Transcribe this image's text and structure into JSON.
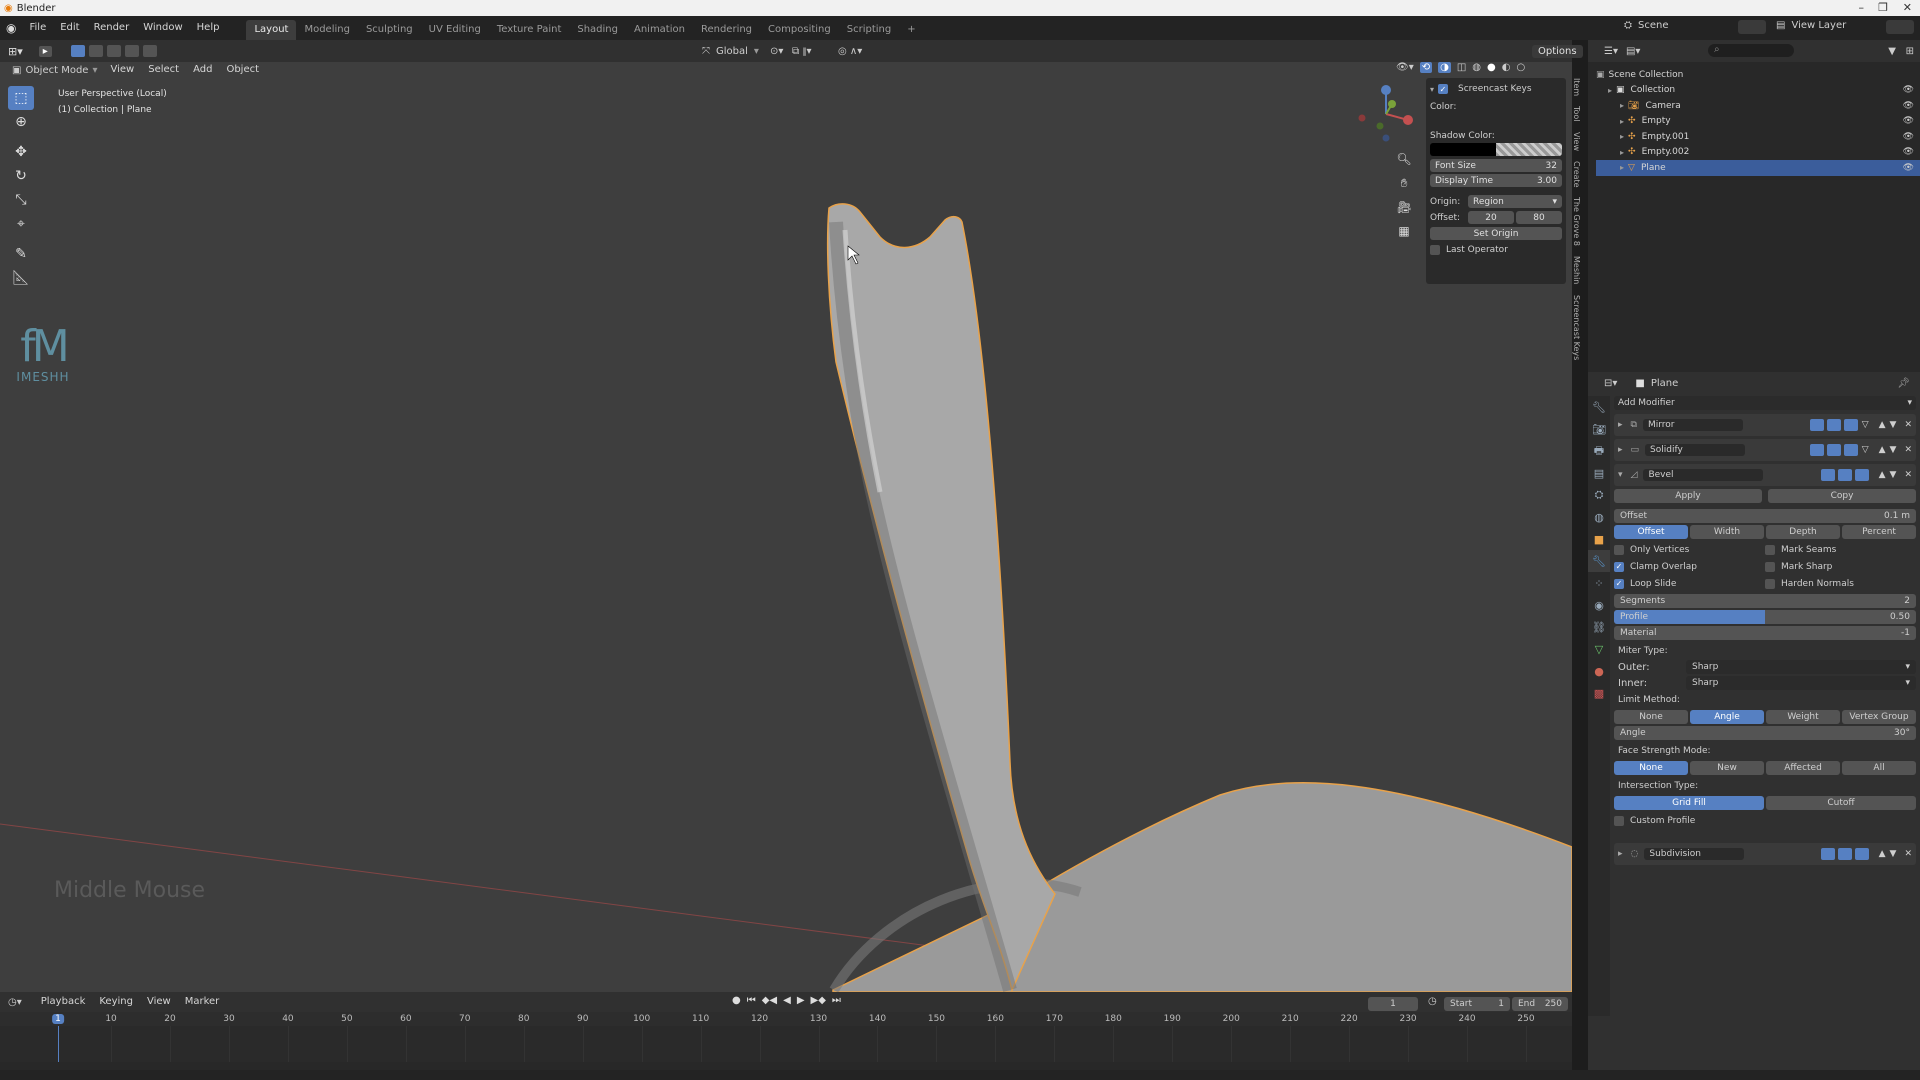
{
  "app": {
    "title": "Blender"
  },
  "menu": [
    "File",
    "Edit",
    "Render",
    "Window",
    "Help"
  ],
  "workspaces": [
    "Layout",
    "Modeling",
    "Sculpting",
    "UV Editing",
    "Texture Paint",
    "Shading",
    "Animation",
    "Rendering",
    "Compositing",
    "Scripting",
    "+"
  ],
  "top_right": {
    "scene": "Scene",
    "view_layer": "View Layer"
  },
  "viewport_header": {
    "mode": "Object Mode",
    "menus": [
      "View",
      "Select",
      "Add",
      "Object"
    ],
    "orientation": "Global",
    "options": "Options"
  },
  "viewport": {
    "perspective": "User Perspective (Local)",
    "collection": "(1) Collection | Plane",
    "overlay_text": "Middle Mouse",
    "logo_letters": "fM",
    "logo_text": "IMESHH"
  },
  "screencast": {
    "title": "Screencast Keys",
    "color_label": "Color:",
    "shadow_color_label": "Shadow Color:",
    "font_size_label": "Font Size",
    "font_size": "32",
    "display_time_label": "Display Time",
    "display_time": "3.00",
    "origin_label": "Origin:",
    "origin": "Region",
    "offset_label": "Offset:",
    "offset_x": "20",
    "offset_y": "80",
    "set_origin": "Set Origin",
    "last_operator": "Last Operator"
  },
  "side_tabs": [
    "Item",
    "Tool",
    "View",
    "Create",
    "The Grove 8",
    "Meshin",
    "Screencast Keys"
  ],
  "outliner": {
    "root": "Scene Collection",
    "items": [
      {
        "name": "Collection",
        "indent": 1
      },
      {
        "name": "Camera",
        "indent": 2
      },
      {
        "name": "Empty",
        "indent": 2
      },
      {
        "name": "Empty.001",
        "indent": 2
      },
      {
        "name": "Empty.002",
        "indent": 2
      },
      {
        "name": "Plane",
        "indent": 2,
        "selected": true
      }
    ]
  },
  "properties": {
    "object": "Plane",
    "add_modifier": "Add Modifier",
    "modifiers": [
      "Mirror",
      "Solidify",
      "Bevel",
      "Subdivision"
    ],
    "bevel": {
      "apply": "Apply",
      "copy": "Copy",
      "offset_label": "Offset",
      "offset_value": "0.1 m",
      "width_types": [
        "Offset",
        "Width",
        "Depth",
        "Percent"
      ],
      "only_vertices": "Only Vertices",
      "mark_seams": "Mark Seams",
      "clamp_overlap": "Clamp Overlap",
      "mark_sharp": "Mark Sharp",
      "loop_slide": "Loop Slide",
      "harden_normals": "Harden Normals",
      "segments_label": "Segments",
      "segments": "2",
      "profile_label": "Profile",
      "profile": "0.50",
      "profile_fraction": 0.5,
      "material_label": "Material",
      "material": "-1",
      "miter_type": "Miter Type:",
      "outer_label": "Outer:",
      "outer": "Sharp",
      "inner_label": "Inner:",
      "inner": "Sharp",
      "limit_method": "Limit Method:",
      "limit_options": [
        "None",
        "Angle",
        "Weight",
        "Vertex Group"
      ],
      "angle_label": "Angle",
      "angle": "30°",
      "face_strength": "Face Strength Mode:",
      "face_options": [
        "None",
        "New",
        "Affected",
        "All"
      ],
      "intersection": "Intersection Type:",
      "intersection_options": [
        "Grid Fill",
        "Cutoff"
      ],
      "custom_profile": "Custom Profile"
    }
  },
  "timeline": {
    "menus": [
      "Playback",
      "Keying",
      "View",
      "Marker"
    ],
    "current_frame": "1",
    "start_label": "Start",
    "start": "1",
    "end_label": "End",
    "end": "250",
    "ticks": [
      "1",
      "10",
      "20",
      "30",
      "40",
      "50",
      "60",
      "70",
      "80",
      "90",
      "100",
      "110",
      "120",
      "130",
      "140",
      "150",
      "160",
      "170",
      "180",
      "190",
      "200",
      "210",
      "220",
      "230",
      "240",
      "250"
    ]
  },
  "colors": {
    "accent": "#5680c2",
    "outline": "#e8a24a",
    "viewport_bg": "#3e3e3e",
    "axis_red": "#a04848"
  }
}
